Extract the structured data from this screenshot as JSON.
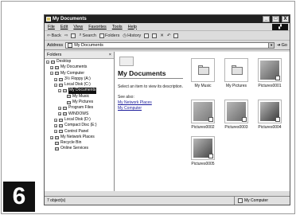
{
  "step_number": "6",
  "window": {
    "title": "My Documents",
    "buttons": {
      "minimize": "_",
      "maximize": "□",
      "close": "X"
    },
    "menu": [
      "File",
      "Edit",
      "View",
      "Favorites",
      "Tools",
      "Help"
    ],
    "toolbar": {
      "back": "Back",
      "search": "Search",
      "folders": "Folders",
      "history": "History"
    },
    "address": {
      "label": "Address",
      "value": "My Documents",
      "go": "Go"
    }
  },
  "folders_pane": {
    "title": "Folders",
    "close": "×",
    "items": [
      {
        "label": "Desktop",
        "indent": 0,
        "expander": "−"
      },
      {
        "label": "My Documents",
        "indent": 1,
        "expander": "+"
      },
      {
        "label": "My Computer",
        "indent": 1,
        "expander": "−"
      },
      {
        "label": "3½ Floppy (A:)",
        "indent": 2,
        "expander": "+"
      },
      {
        "label": "Local Disk (C:)",
        "indent": 2,
        "expander": "−"
      },
      {
        "label": "My Documents",
        "indent": 3,
        "expander": "−",
        "selected": true
      },
      {
        "label": "My Music",
        "indent": 4,
        "expander": ""
      },
      {
        "label": "My Pictures",
        "indent": 4,
        "expander": ""
      },
      {
        "label": "Program Files",
        "indent": 3,
        "expander": "+"
      },
      {
        "label": "WINDOWS",
        "indent": 3,
        "expander": "+"
      },
      {
        "label": "Local Disk (D:)",
        "indent": 2,
        "expander": "+"
      },
      {
        "label": "Compact Disc (E:)",
        "indent": 2,
        "expander": "+"
      },
      {
        "label": "Control Panel",
        "indent": 2,
        "expander": "+"
      },
      {
        "label": "My Network Places",
        "indent": 1,
        "expander": "+"
      },
      {
        "label": "Recycle Bin",
        "indent": 1,
        "expander": ""
      },
      {
        "label": "Online Services",
        "indent": 1,
        "expander": ""
      }
    ]
  },
  "task_pane": {
    "title": "My Documents",
    "description": "Select an item to view its description.",
    "see_also": "See also:",
    "links": [
      "My Network Places",
      "My Computer"
    ]
  },
  "files": [
    {
      "label": "My Music",
      "kind": "folder"
    },
    {
      "label": "My Pictures",
      "kind": "folder"
    },
    {
      "label": "Pictures0001",
      "kind": "photo"
    },
    {
      "label": "Pictures0002",
      "kind": "photo"
    },
    {
      "label": "Pictures0003",
      "kind": "photo"
    },
    {
      "label": "Pictures0004",
      "kind": "photo"
    },
    {
      "label": "Pictures0005",
      "kind": "photo"
    }
  ],
  "status": {
    "left": "7 object(s)",
    "right": "My Computer"
  }
}
